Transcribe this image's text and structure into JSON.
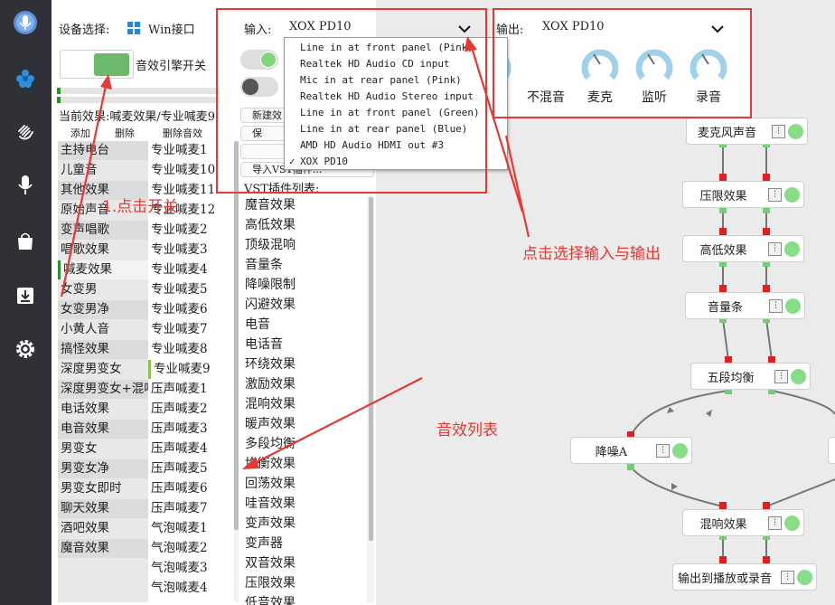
{
  "header": {
    "device_label": "设备选择:",
    "device_value": "Win接口",
    "engine_label": "音效引擎开关",
    "input_label": "输入:",
    "input_value": "XOX PD10",
    "output_label": "输出:",
    "output_value": "XOX PD10"
  },
  "input_dropdown": [
    "Line in at front panel (Pink)",
    "Realtek HD Audio CD input",
    "Mic in at rear panel (Pink)",
    "Realtek HD Audio Stereo input",
    "Line in at front panel (Green)",
    "Line in at rear panel (Blue)",
    "AMD HD Audio HDMI out #3",
    "XOX PD10"
  ],
  "knobs": [
    "不混音",
    "麦克",
    "监听",
    "录音"
  ],
  "effects": {
    "current": "当前效果:喊麦效果/专业喊麦9",
    "add": "添加",
    "delete": "删除",
    "delete_fx": "删除音效",
    "list_a": [
      "主持电台",
      "儿童音",
      "其他效果",
      "原始声音",
      "变声唱歌",
      "唱歌效果",
      "喊麦效果",
      "女变男",
      "女变男净",
      "小黄人音",
      "搞怪效果",
      "深度男变女",
      "深度男变女+混响",
      "电话效果",
      "电音效果",
      "男变女",
      "男变女净",
      "男变女即时",
      "聊天效果",
      "酒吧效果",
      "魔音效果"
    ],
    "list_b": [
      "专业喊麦1",
      "专业喊麦10",
      "专业喊麦11",
      "专业喊麦12",
      "专业喊麦2",
      "专业喊麦3",
      "专业喊麦4",
      "专业喊麦5",
      "专业喊麦6",
      "专业喊麦7",
      "专业喊麦8",
      "专业喊麦9",
      "压声喊麦1",
      "压声喊麦2",
      "压声喊麦3",
      "压声喊麦4",
      "压声喊麦5",
      "压声喊麦6",
      "压声喊麦7",
      "气泡喊麦1",
      "气泡喊麦2",
      "气泡喊麦3",
      "气泡喊麦4"
    ]
  },
  "mid_buttons": [
    "新建效",
    "保",
    "",
    "导入VST插件..."
  ],
  "vst": {
    "title": "VST插件列表:",
    "items": [
      "魔音效果",
      "高低效果",
      "顶级混响",
      "音量条",
      "降噪限制",
      "闪避效果",
      "电音",
      "电话音",
      "环绕效果",
      "激励效果",
      "混响效果",
      "暖声效果",
      "多段均衡",
      "均衡效果",
      "回荡效果",
      "哇音效果",
      "变声效果",
      "变声器",
      "双音效果",
      "压限效果",
      "低音效果"
    ]
  },
  "chain": [
    "麦克风声音",
    "压限效果",
    "高低效果",
    "音量条",
    "五段均衡",
    "降噪A",
    "混响效果",
    "输出到播放或录音"
  ],
  "annotations": {
    "click_toggle": "1.点击开关",
    "select_io": "点击选择输入与输出",
    "effect_list": "音效列表"
  },
  "colors": {
    "accent_red": "#e53935",
    "toggle_green": "#6db86b",
    "rail": "#2f3136",
    "knob_blue": "#9fd2ea"
  }
}
